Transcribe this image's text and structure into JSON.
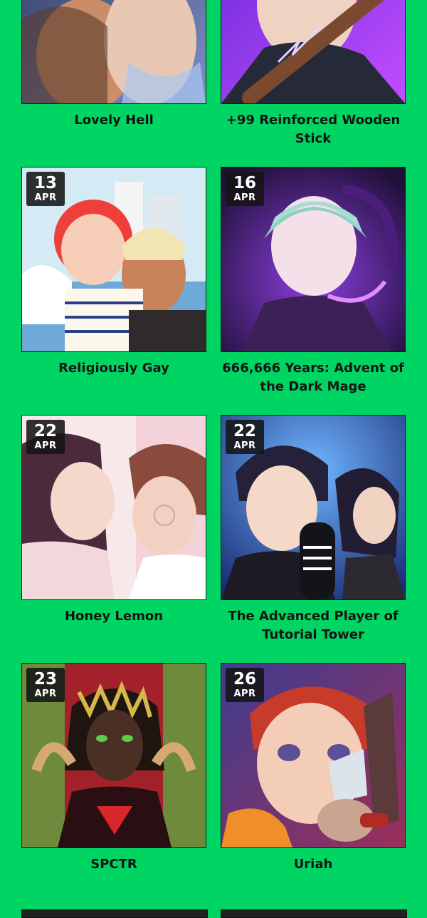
{
  "accent_color": "#00d564",
  "cards": [
    {
      "title": "Lovely Hell",
      "day": "",
      "month": "",
      "icon": "cover-art-icon"
    },
    {
      "title": "+99 Reinforced Wooden Stick",
      "day": "",
      "month": "",
      "icon": "cover-art-icon"
    },
    {
      "title": "Religiously Gay",
      "day": "13",
      "month": "APR",
      "icon": "cover-art-icon"
    },
    {
      "title": "666,666 Years: Advent of the Dark Mage",
      "day": "16",
      "month": "APR",
      "icon": "cover-art-icon"
    },
    {
      "title": "Honey Lemon",
      "day": "22",
      "month": "APR",
      "icon": "cover-art-icon"
    },
    {
      "title": "The Advanced Player of Tutorial Tower",
      "day": "22",
      "month": "APR",
      "icon": "cover-art-icon"
    },
    {
      "title": "SPCTR",
      "day": "23",
      "month": "APR",
      "icon": "cover-art-icon"
    },
    {
      "title": "Uriah",
      "day": "26",
      "month": "APR",
      "icon": "cover-art-icon"
    }
  ]
}
